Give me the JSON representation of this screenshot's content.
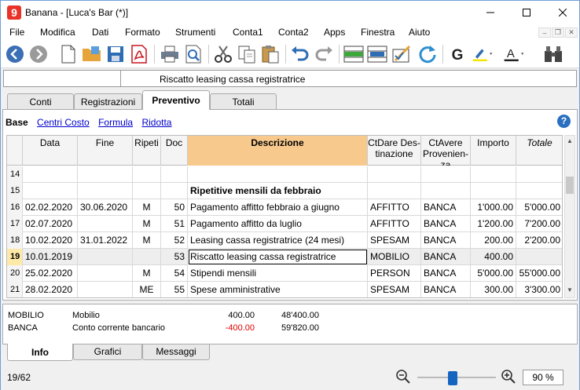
{
  "window": {
    "title": "Banana - [Luca's Bar  (*)]"
  },
  "menu": [
    "File",
    "Modifica",
    "Dati",
    "Formato",
    "Strumenti",
    "Conta1",
    "Conta2",
    "Apps",
    "Finestra",
    "Aiuto"
  ],
  "cellbar": {
    "content": "Riscatto leasing cassa registratrice"
  },
  "tabs": [
    "Conti",
    "Registrazioni",
    "Preventivo",
    "Totali"
  ],
  "active_tab": "Preventivo",
  "views": [
    "Base",
    "Centri Costo",
    "Formula",
    "Ridotta"
  ],
  "columns": [
    "Data",
    "Fine",
    "Ripeti",
    "Doc",
    "Descrizione",
    "CtDare Destinazione",
    "CtAvere Provenienza",
    "Importo",
    "Totale"
  ],
  "column_header_lines": {
    "ctdare": [
      "CtDare  Des-",
      "tinazione"
    ],
    "ctavere": [
      "CtAvere",
      "Provenien-",
      "za"
    ]
  },
  "rows": [
    {
      "n": "14",
      "data": "",
      "fine": "",
      "ripeti": "",
      "doc": "",
      "desc": "",
      "dare": "",
      "avere": "",
      "importo": "",
      "totale": ""
    },
    {
      "n": "15",
      "data": "",
      "fine": "",
      "ripeti": "",
      "doc": "",
      "desc": "Ripetitive mensili da febbraio",
      "dare": "",
      "avere": "",
      "importo": "",
      "totale": ""
    },
    {
      "n": "16",
      "data": "02.02.2020",
      "fine": "30.06.2020",
      "ripeti": "M",
      "doc": "50",
      "desc": "Pagamento affitto febbraio a giugno",
      "dare": "AFFITTO",
      "avere": "BANCA",
      "importo": "1'000.00",
      "totale": "5'000.00"
    },
    {
      "n": "17",
      "data": "02.07.2020",
      "fine": "",
      "ripeti": "M",
      "doc": "51",
      "desc": "Pagamento affitto da luglio",
      "dare": "AFFITTO",
      "avere": "BANCA",
      "importo": "1'200.00",
      "totale": "7'200.00"
    },
    {
      "n": "18",
      "data": "10.02.2020",
      "fine": "31.01.2022",
      "ripeti": "M",
      "doc": "52",
      "desc": "Leasing cassa registratrice (24 mesi)",
      "dare": "SPESAM",
      "avere": "BANCA",
      "importo": "200.00",
      "totale": "2'200.00"
    },
    {
      "n": "19",
      "data": "10.01.2019",
      "fine": "",
      "ripeti": "",
      "doc": "53",
      "desc": "Riscatto leasing cassa registratrice",
      "dare": "MOBILIO",
      "avere": "BANCA",
      "importo": "400.00",
      "totale": ""
    },
    {
      "n": "20",
      "data": "25.02.2020",
      "fine": "",
      "ripeti": "M",
      "doc": "54",
      "desc": "Stipendi mensili",
      "dare": "PERSON",
      "avere": "BANCA",
      "importo": "5'000.00",
      "totale": "55'000.00"
    },
    {
      "n": "21",
      "data": "28.02.2020",
      "fine": "",
      "ripeti": "ME",
      "doc": "55",
      "desc": "Spese amministrative",
      "dare": "SPESAM",
      "avere": "BANCA",
      "importo": "300.00",
      "totale": "3'300.00"
    }
  ],
  "info": [
    {
      "account": "MOBILIO",
      "desc": "Mobilio",
      "amount": "400.00",
      "balance": "48'400.00"
    },
    {
      "account": "BANCA",
      "desc": "Conto corrente bancario",
      "amount": "-400.00",
      "balance": "59'820.00"
    }
  ],
  "bottom_tabs": [
    "Info",
    "Grafici",
    "Messaggi"
  ],
  "status": {
    "position": "19/62",
    "zoom": "90",
    "zoom_unit": "%",
    "zoom_level": 0.45
  },
  "colors": {
    "header_highlight": "#f7c98d",
    "negative": "#e00000",
    "accent": "#1565c0"
  }
}
